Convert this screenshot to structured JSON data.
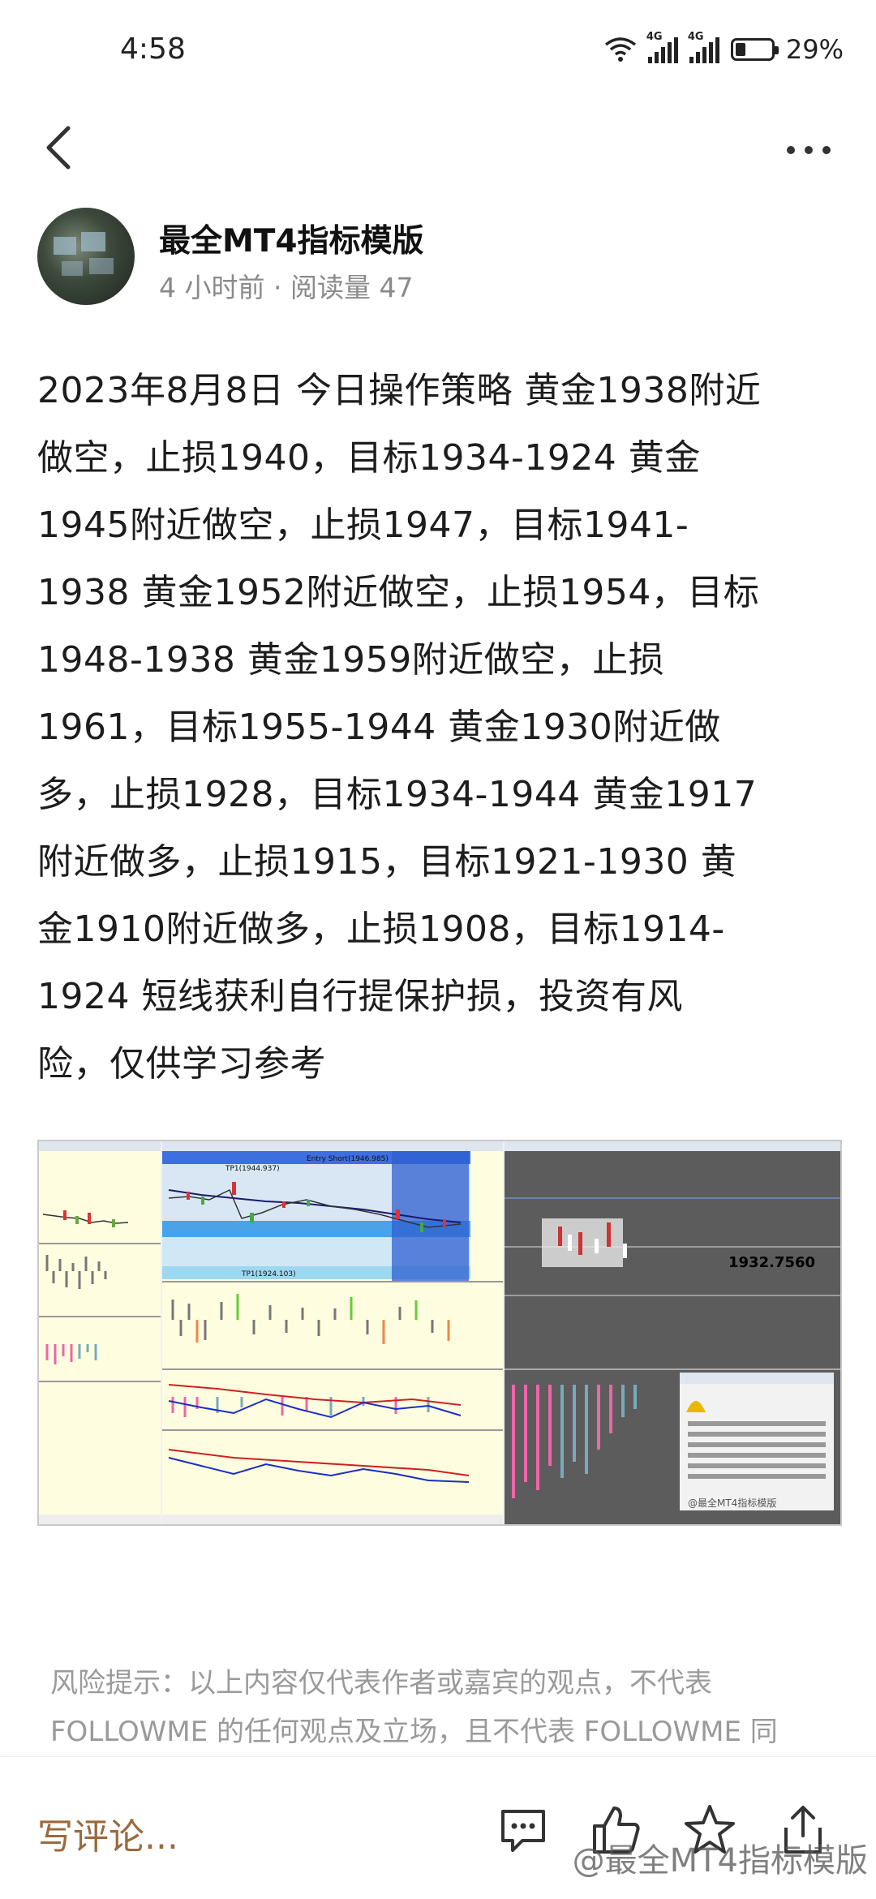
{
  "status_bar": {
    "time": "4:58",
    "network_1": "4G",
    "network_2": "4G",
    "battery_percent": "29%",
    "battery_level": 0.29
  },
  "nav": {
    "back_icon": "chevron-left-icon",
    "more_icon": "more-horizontal-icon"
  },
  "author": {
    "name": "最全MT4指标模版",
    "meta": "4 小时前 · 阅读量 47"
  },
  "article": {
    "lines": [
      "2023年8月8日 今日操作策略 黄金1938附近",
      "做空，止损1940，目标1934-1924 黄金",
      "1945附近做空，止损1947，目标1941-",
      "1938 黄金1952附近做空，止损1954，目标",
      "1948-1938 黄金1959附近做空，止损",
      "1961，目标1955-1944 黄金1930附近做",
      "多，止损1928，目标1934-1944 黄金1917",
      "附近做多，止损1915，目标1921-1930 黄",
      "金1910附近做多，止损1908，目标1914-",
      "1924 短线获利自行提保护损，投资有风",
      "险，仅供学习参考"
    ]
  },
  "image": {
    "price_label": "1932.7560",
    "entry_label": "Entry Short(1946.985)",
    "tp1_label": "TP1(1944.937)",
    "tp2_label": "TP1(1924.103)",
    "image_watermark": "@最全MT4指标模版"
  },
  "disclaimer": {
    "lines": [
      "风险提示：以上内容仅代表作者或嘉宾的观点，不代表",
      "FOLLOWME 的任何观点及立场，且不代表 FOLLOWME 同"
    ]
  },
  "bottom_bar": {
    "comment_placeholder": "写评论...",
    "watermark": "@最全MT4指标模版",
    "accent_color": "#9b6a3c"
  }
}
